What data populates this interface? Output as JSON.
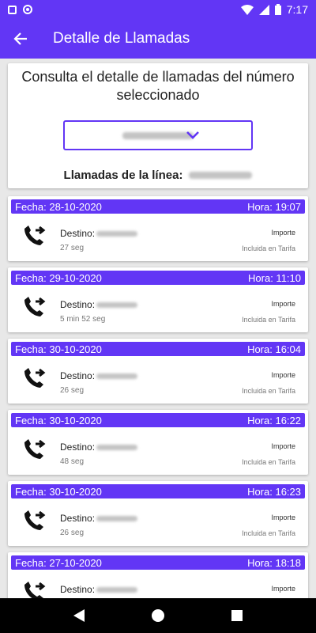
{
  "status_bar": {
    "time": "7:17"
  },
  "app_bar": {
    "title": "Detalle de Llamadas"
  },
  "header_card": {
    "title": "Consulta el detalle de llamadas del número seleccionado",
    "line_label": "Llamadas de la línea:"
  },
  "labels": {
    "fecha_prefix": "Fecha:",
    "hora_prefix": "Hora:",
    "destino": "Destino:",
    "importe": "Importe"
  },
  "calls": [
    {
      "fecha": "Fecha: 28-10-2020",
      "hora": "Hora: 19:07",
      "destino": "Destino:",
      "duracion": "27 seg",
      "importe_label": "Importe",
      "importe_valor": "Incluida en Tarifa"
    },
    {
      "fecha": "Fecha: 29-10-2020",
      "hora": "Hora: 11:10",
      "destino": "Destino:",
      "duracion": "5 min 52 seg",
      "importe_label": "Importe",
      "importe_valor": "Incluida en Tarifa"
    },
    {
      "fecha": "Fecha: 30-10-2020",
      "hora": "Hora: 16:04",
      "destino": "Destino:",
      "duracion": "26 seg",
      "importe_label": "Importe",
      "importe_valor": "Incluida en Tarifa"
    },
    {
      "fecha": "Fecha: 30-10-2020",
      "hora": "Hora: 16:22",
      "destino": "Destino:",
      "duracion": "48 seg",
      "importe_label": "Importe",
      "importe_valor": "Incluida en Tarifa"
    },
    {
      "fecha": "Fecha: 30-10-2020",
      "hora": "Hora: 16:23",
      "destino": "Destino:",
      "duracion": "26 seg",
      "importe_label": "Importe",
      "importe_valor": "Incluida en Tarifa"
    },
    {
      "fecha": "Fecha: 27-10-2020",
      "hora": "Hora: 18:18",
      "destino": "Destino:",
      "duracion": "",
      "importe_label": "Importe",
      "importe_valor": ""
    }
  ],
  "colors": {
    "accent": "#6236f5",
    "background": "#e8e8e8",
    "card": "#ffffff"
  },
  "icons": {
    "back": "arrow-back-icon",
    "dropdown": "chevron-down-icon",
    "call": "outgoing-call-icon",
    "nav_back": "nav-back-icon",
    "nav_home": "nav-home-icon",
    "nav_recents": "nav-recents-icon"
  }
}
